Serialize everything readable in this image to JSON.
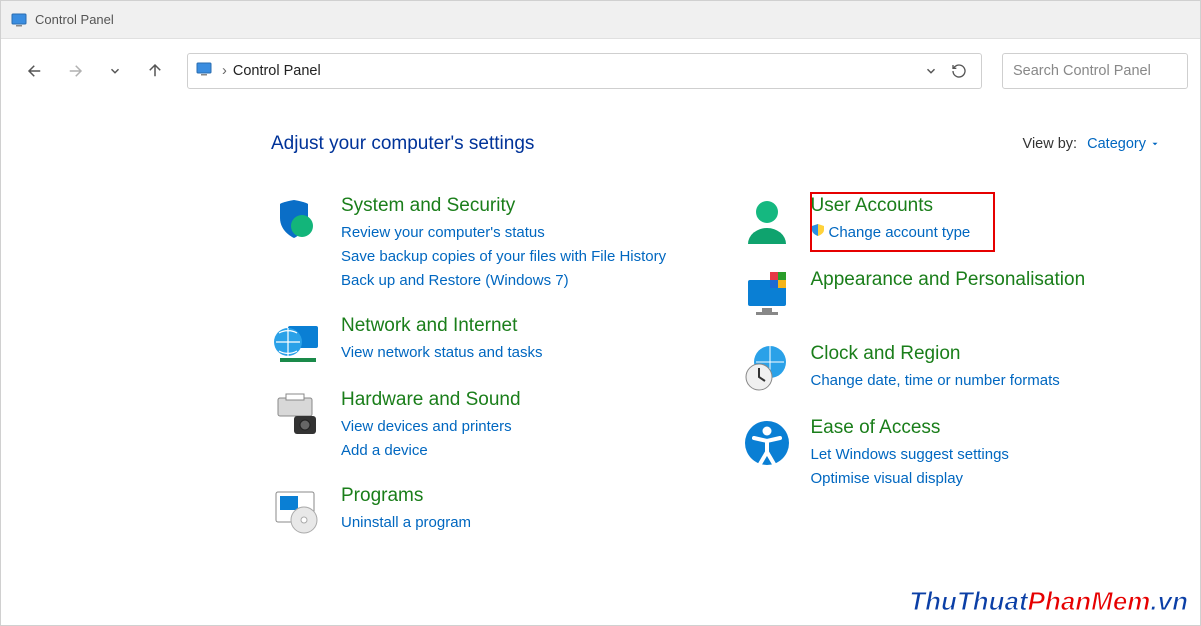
{
  "window": {
    "title": "Control Panel"
  },
  "breadcrumb": {
    "location": "Control Panel"
  },
  "search": {
    "placeholder": "Search Control Panel"
  },
  "heading": "Adjust your computer's settings",
  "viewby": {
    "label": "View by:",
    "value": "Category"
  },
  "left": {
    "system": {
      "title": "System and Security",
      "links": [
        "Review your computer's status",
        "Save backup copies of your files with File History",
        "Back up and Restore (Windows 7)"
      ]
    },
    "network": {
      "title": "Network and Internet",
      "links": [
        "View network status and tasks"
      ]
    },
    "hardware": {
      "title": "Hardware and Sound",
      "links": [
        "View devices and printers",
        "Add a device"
      ]
    },
    "programs": {
      "title": "Programs",
      "links": [
        "Uninstall a program"
      ]
    }
  },
  "right": {
    "user": {
      "title": "User Accounts",
      "links": [
        "Change account type"
      ]
    },
    "appearance": {
      "title": "Appearance and Personalisation"
    },
    "clock": {
      "title": "Clock and Region",
      "links": [
        "Change date, time or number formats"
      ]
    },
    "ease": {
      "title": "Ease of Access",
      "links": [
        "Let Windows suggest settings",
        "Optimise visual display"
      ]
    }
  },
  "watermark": {
    "a": "ThuThuat",
    "b": "PhanMem",
    "c": ".vn"
  }
}
